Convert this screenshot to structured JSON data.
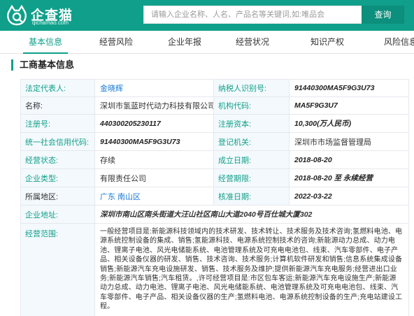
{
  "header": {
    "brand_name": "企查猫",
    "brand_domain": "qichamao.com",
    "search_placeholder": "请输入企业名称、人名、产品名等关键词,如:唯品会",
    "search_button": "查询"
  },
  "tabs": [
    {
      "label": "基本信息",
      "active": true
    },
    {
      "label": "经营风险",
      "active": false
    },
    {
      "label": "企业年报",
      "active": false
    },
    {
      "label": "经营状况",
      "active": false
    },
    {
      "label": "知识产权",
      "active": false
    },
    {
      "label": "风险信息",
      "active": false
    }
  ],
  "section": {
    "title": "工商基本信息"
  },
  "info": {
    "legal_rep_label": "法定代表人:",
    "legal_rep_value": "金晓辉",
    "taxpayer_id_label": "纳税人识别号:",
    "taxpayer_id_value": "91440300MA5F9G3U73",
    "name_label": "名称:",
    "name_value": "深圳市氢蓝时代动力科技有限公司",
    "org_code_label": "机构代码:",
    "org_code_value": "MA5F9G3U7",
    "reg_no_label": "注册号:",
    "reg_no_value": "440300205230117",
    "reg_capital_label": "注册资本:",
    "reg_capital_value": "10,300(万人民币)",
    "credit_code_label": "统一社会信用代码:",
    "credit_code_value": "91440300MA5F9G3U73",
    "authority_label": "登记机关:",
    "authority_value": "深圳市市场监督管理局",
    "status_label": "经营状态:",
    "status_value": "存续",
    "established_label": "成立日期:",
    "established_value": "2018-08-20",
    "type_label": "企业类型:",
    "type_value": "有限责任公司",
    "term_label": "经营期限:",
    "term_value": "2018-08-20 至 永续经营",
    "region_label": "所属地区:",
    "region_value": "广东 南山区",
    "approved_label": "核准日期:",
    "approved_value": "2022-03-22",
    "address_label": "企业地址:",
    "address_value": "深圳市南山区南头街道大汪山社区南山大道2040号百仕城大厦302",
    "scope_label": "经营范围:",
    "scope_value": "一般经营项目是:新能源科技领域内的技术研发、技术转让、技术服务及技术咨询;氢燃料电池、电源系统控制设备的集成、销售;氢能源科技、电源系统控制技术的咨询;新能源动力总成、动力电池、锂离子电池、风光电储能系统、电池管理系统及可充电电池包、线束、汽车零部件、电子产品、相关设备仪器的研发、销售、技术咨询、技术服务;计算机软件研发和销售;信息系统集成设备销售;新能源汽车充电设施研发、销售、技术服务及维护;提供新能源汽车充电服务;经营进出口业务;新能源汽车销售;汽车租赁。,许可经营项目是:市区包车客运;新能源汽车充电设施生产;新能源动力总成、动力电池、锂离子电池、风光电储能系统、电池管理系统及可充电电池包、线束、汽车零部件、电子产品、相关设备仪器的生产;氢燃料电池、电源系统控制设备的生产;充电站建设工程。"
  },
  "colors": {
    "brand": "#0f9f8a",
    "label_bg": "#f3f9fd",
    "link": "#1a7ad6"
  }
}
